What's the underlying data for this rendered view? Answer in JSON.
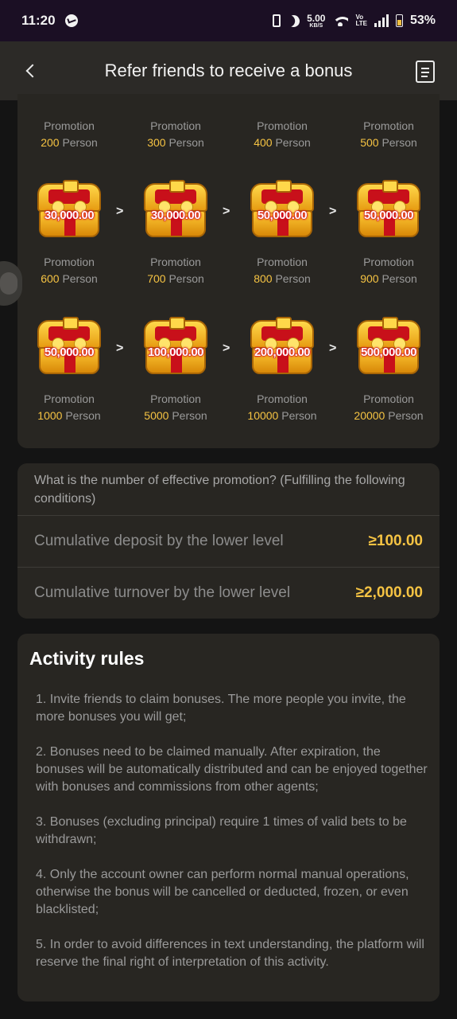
{
  "status_bar": {
    "time": "11:20",
    "net_speed_value": "5.00",
    "net_speed_unit": "KB/S",
    "volte_top": "Vo",
    "volte_bottom": "LTE",
    "battery": "53%"
  },
  "header": {
    "title": "Refer friends to receive a bonus"
  },
  "promotion_label": "Promotion",
  "person_unit": "Person",
  "top_labels": [
    "200",
    "300",
    "400",
    "500"
  ],
  "row1": {
    "amounts": [
      "30,000.00",
      "30,000.00",
      "50,000.00",
      "50,000.00"
    ],
    "labels": [
      "600",
      "700",
      "800",
      "900"
    ]
  },
  "row2": {
    "amounts": [
      "50,000.00",
      "100,000.00",
      "200,000.00",
      "500,000.00"
    ],
    "labels": [
      "1000",
      "5000",
      "10000",
      "20000"
    ]
  },
  "arrow_glyph": ">",
  "conditions": {
    "question": "What is the number of effective promotion? (Fulfilling the following conditions)",
    "items": [
      {
        "label": "Cumulative deposit by the lower level",
        "value": "≥100.00"
      },
      {
        "label": "Cumulative turnover by the lower level",
        "value": "≥2,000.00"
      }
    ]
  },
  "rules": {
    "title": "Activity rules",
    "items": [
      "1. Invite friends to claim bonuses. The more people you invite, the more bonuses you will get;",
      "2. Bonuses need to be claimed manually. After expiration, the bonuses will be automatically distributed and can be enjoyed together with bonuses and commissions from other agents;",
      "3. Bonuses (excluding principal) require 1 times of valid bets to be withdrawn;",
      "4. Only the account owner can perform normal manual operations, otherwise the bonus will be cancelled or deducted, frozen, or even blacklisted;",
      "5. In order to avoid differences in text understanding, the platform will reserve the final right of interpretation of this activity."
    ]
  },
  "icons": {
    "back": "chevron-left-icon",
    "rules_doc": "document-icon",
    "reward": "treasure-chest-icon"
  },
  "colors": {
    "accent": "#f5c343",
    "card_bg": "#282622",
    "page_bg": "#141414",
    "nav_bg": "#2c2a27",
    "status_bg": "#1b0f24"
  }
}
